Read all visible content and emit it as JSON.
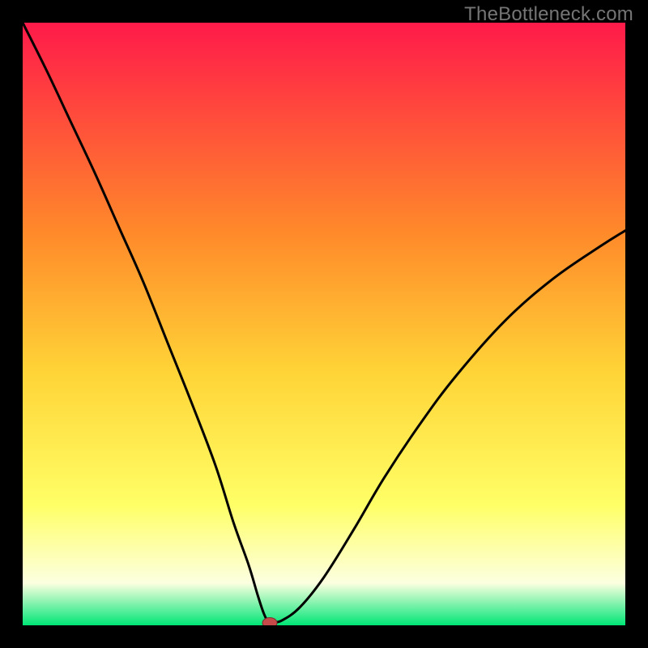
{
  "watermark": "TheBottleneck.com",
  "colors": {
    "frame_bg": "#000000",
    "gradient_top": "#ff1a4a",
    "gradient_mid_upper": "#ff8a2a",
    "gradient_mid": "#ffd437",
    "gradient_mid_lower": "#ffff66",
    "gradient_low": "#fcffe0",
    "gradient_bottom": "#00e676",
    "curve": "#000000",
    "marker_fill": "#c74a4a",
    "marker_stroke": "#7a2e2e"
  },
  "chart_data": {
    "type": "line",
    "title": "",
    "xlabel": "",
    "ylabel": "",
    "xlim": [
      0,
      100
    ],
    "ylim": [
      0,
      100
    ],
    "legend": false,
    "grid": false,
    "series": [
      {
        "name": "bottleneck-curve",
        "x": [
          0,
          4,
          8,
          12,
          16,
          20,
          24,
          28,
          32,
          35,
          37.5,
          39,
          40,
          40.8,
          41.5,
          43,
          46,
          50,
          55,
          60,
          66,
          72,
          80,
          88,
          96,
          100
        ],
        "y": [
          100,
          92,
          83.5,
          75,
          66,
          57,
          47,
          37,
          26.5,
          17,
          10,
          5,
          2,
          0.5,
          0.5,
          0.8,
          3,
          8,
          16,
          24.5,
          33.5,
          41.5,
          50.5,
          57.5,
          63,
          65.5
        ]
      }
    ],
    "optimum_marker": {
      "x": 41,
      "y": 0.4
    },
    "annotations": []
  }
}
